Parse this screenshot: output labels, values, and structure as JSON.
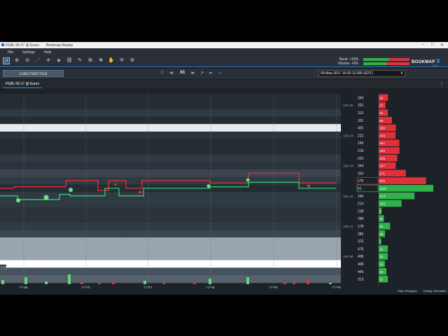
{
  "window": {
    "title": "FGBL 06-17 @ Eurex",
    "caption": "Bookmap Replay",
    "controls": [
      "–",
      "□",
      "✕"
    ]
  },
  "menu": [
    "File",
    "Settings",
    "Help"
  ],
  "toolbar": {
    "icons": [
      "pointer-icon",
      "zoom-in-icon",
      "zoom-out-icon",
      "share-icon",
      "crosshair-icon",
      "fill-icon",
      "link-icon",
      "pencil-icon",
      "layers-icon",
      "snowflake-icon",
      "hand-icon",
      "shield-icon",
      "sliders-icon"
    ]
  },
  "stats": {
    "book_label": "Book:",
    "book_value": "+10%",
    "volume_label": "Volume:",
    "volume_value": "+0%",
    "book_green_fraction": 0.55,
    "volume_green_fraction": 0.5
  },
  "logo": {
    "text": "BOOKMAP",
    "x": "X",
    "sub": "RAY"
  },
  "nav": {
    "load_feed": "LOAD FEED FILE",
    "speed": "X1",
    "datetime": "09-May-2017 10:32:13.000 (EDT)"
  },
  "tab": {
    "label": "FGBL 06-17 @ Eurex"
  },
  "columns": {
    "cob": "COB",
    "cqc": "CQC"
  },
  "chart_data": {
    "type": "line",
    "x_ticks": [
      "12:48",
      "12:50",
      "12:52",
      "12:54",
      "12:56",
      "12:58"
    ],
    "price_labels": [
      {
        "price": "160.45",
        "row": 1
      },
      {
        "price": "160.44",
        "row": 5
      },
      {
        "price": "160.43",
        "row": 9
      },
      {
        "price": "160.42",
        "row": 13
      },
      {
        "price": "160.41",
        "row": 17
      },
      {
        "price": "160.40",
        "row": 21
      }
    ],
    "book_rows": [
      {
        "size": "243",
        "cqc": "32"
      },
      {
        "size": "222",
        "cqc": "17"
      },
      {
        "size": "313",
        "cqc": "31"
      },
      {
        "size": "331",
        "cqc": "65"
      },
      {
        "size": "401",
        "cqc": "109"
      },
      {
        "size": "222",
        "cqc": "104"
      },
      {
        "size": "193",
        "cqc": "157"
      },
      {
        "size": "219",
        "cqc": "160"
      },
      {
        "size": "223",
        "cqc": "128"
      },
      {
        "size": "344",
        "cqc": "107"
      },
      {
        "size": "333",
        "cqc": "271"
      },
      {
        "size": "175",
        "cqc": "825"
      },
      {
        "size": "51",
        "cqc": "1102"
      },
      {
        "size": "245",
        "cqc": "473"
      },
      {
        "size": "214",
        "cqc": "193"
      },
      {
        "size": "238",
        "cqc": "3"
      },
      {
        "size": "288",
        "cqc": "10"
      },
      {
        "size": "178",
        "cqc": "48"
      },
      {
        "size": "282",
        "cqc": "15"
      },
      {
        "size": "375",
        "cqc": "2"
      },
      {
        "size": "478",
        "cqc": "31"
      },
      {
        "size": "409",
        "cqc": "30"
      },
      {
        "size": "408",
        "cqc": "14"
      },
      {
        "size": "449",
        "cqc": "22"
      },
      {
        "size": "313",
        "cqc": "31"
      }
    ],
    "bid_row": 12,
    "ask_row": 11,
    "left_label": "375"
  },
  "status": {
    "data": "Data: Replayed",
    "trading": "Trading: Simulated"
  }
}
